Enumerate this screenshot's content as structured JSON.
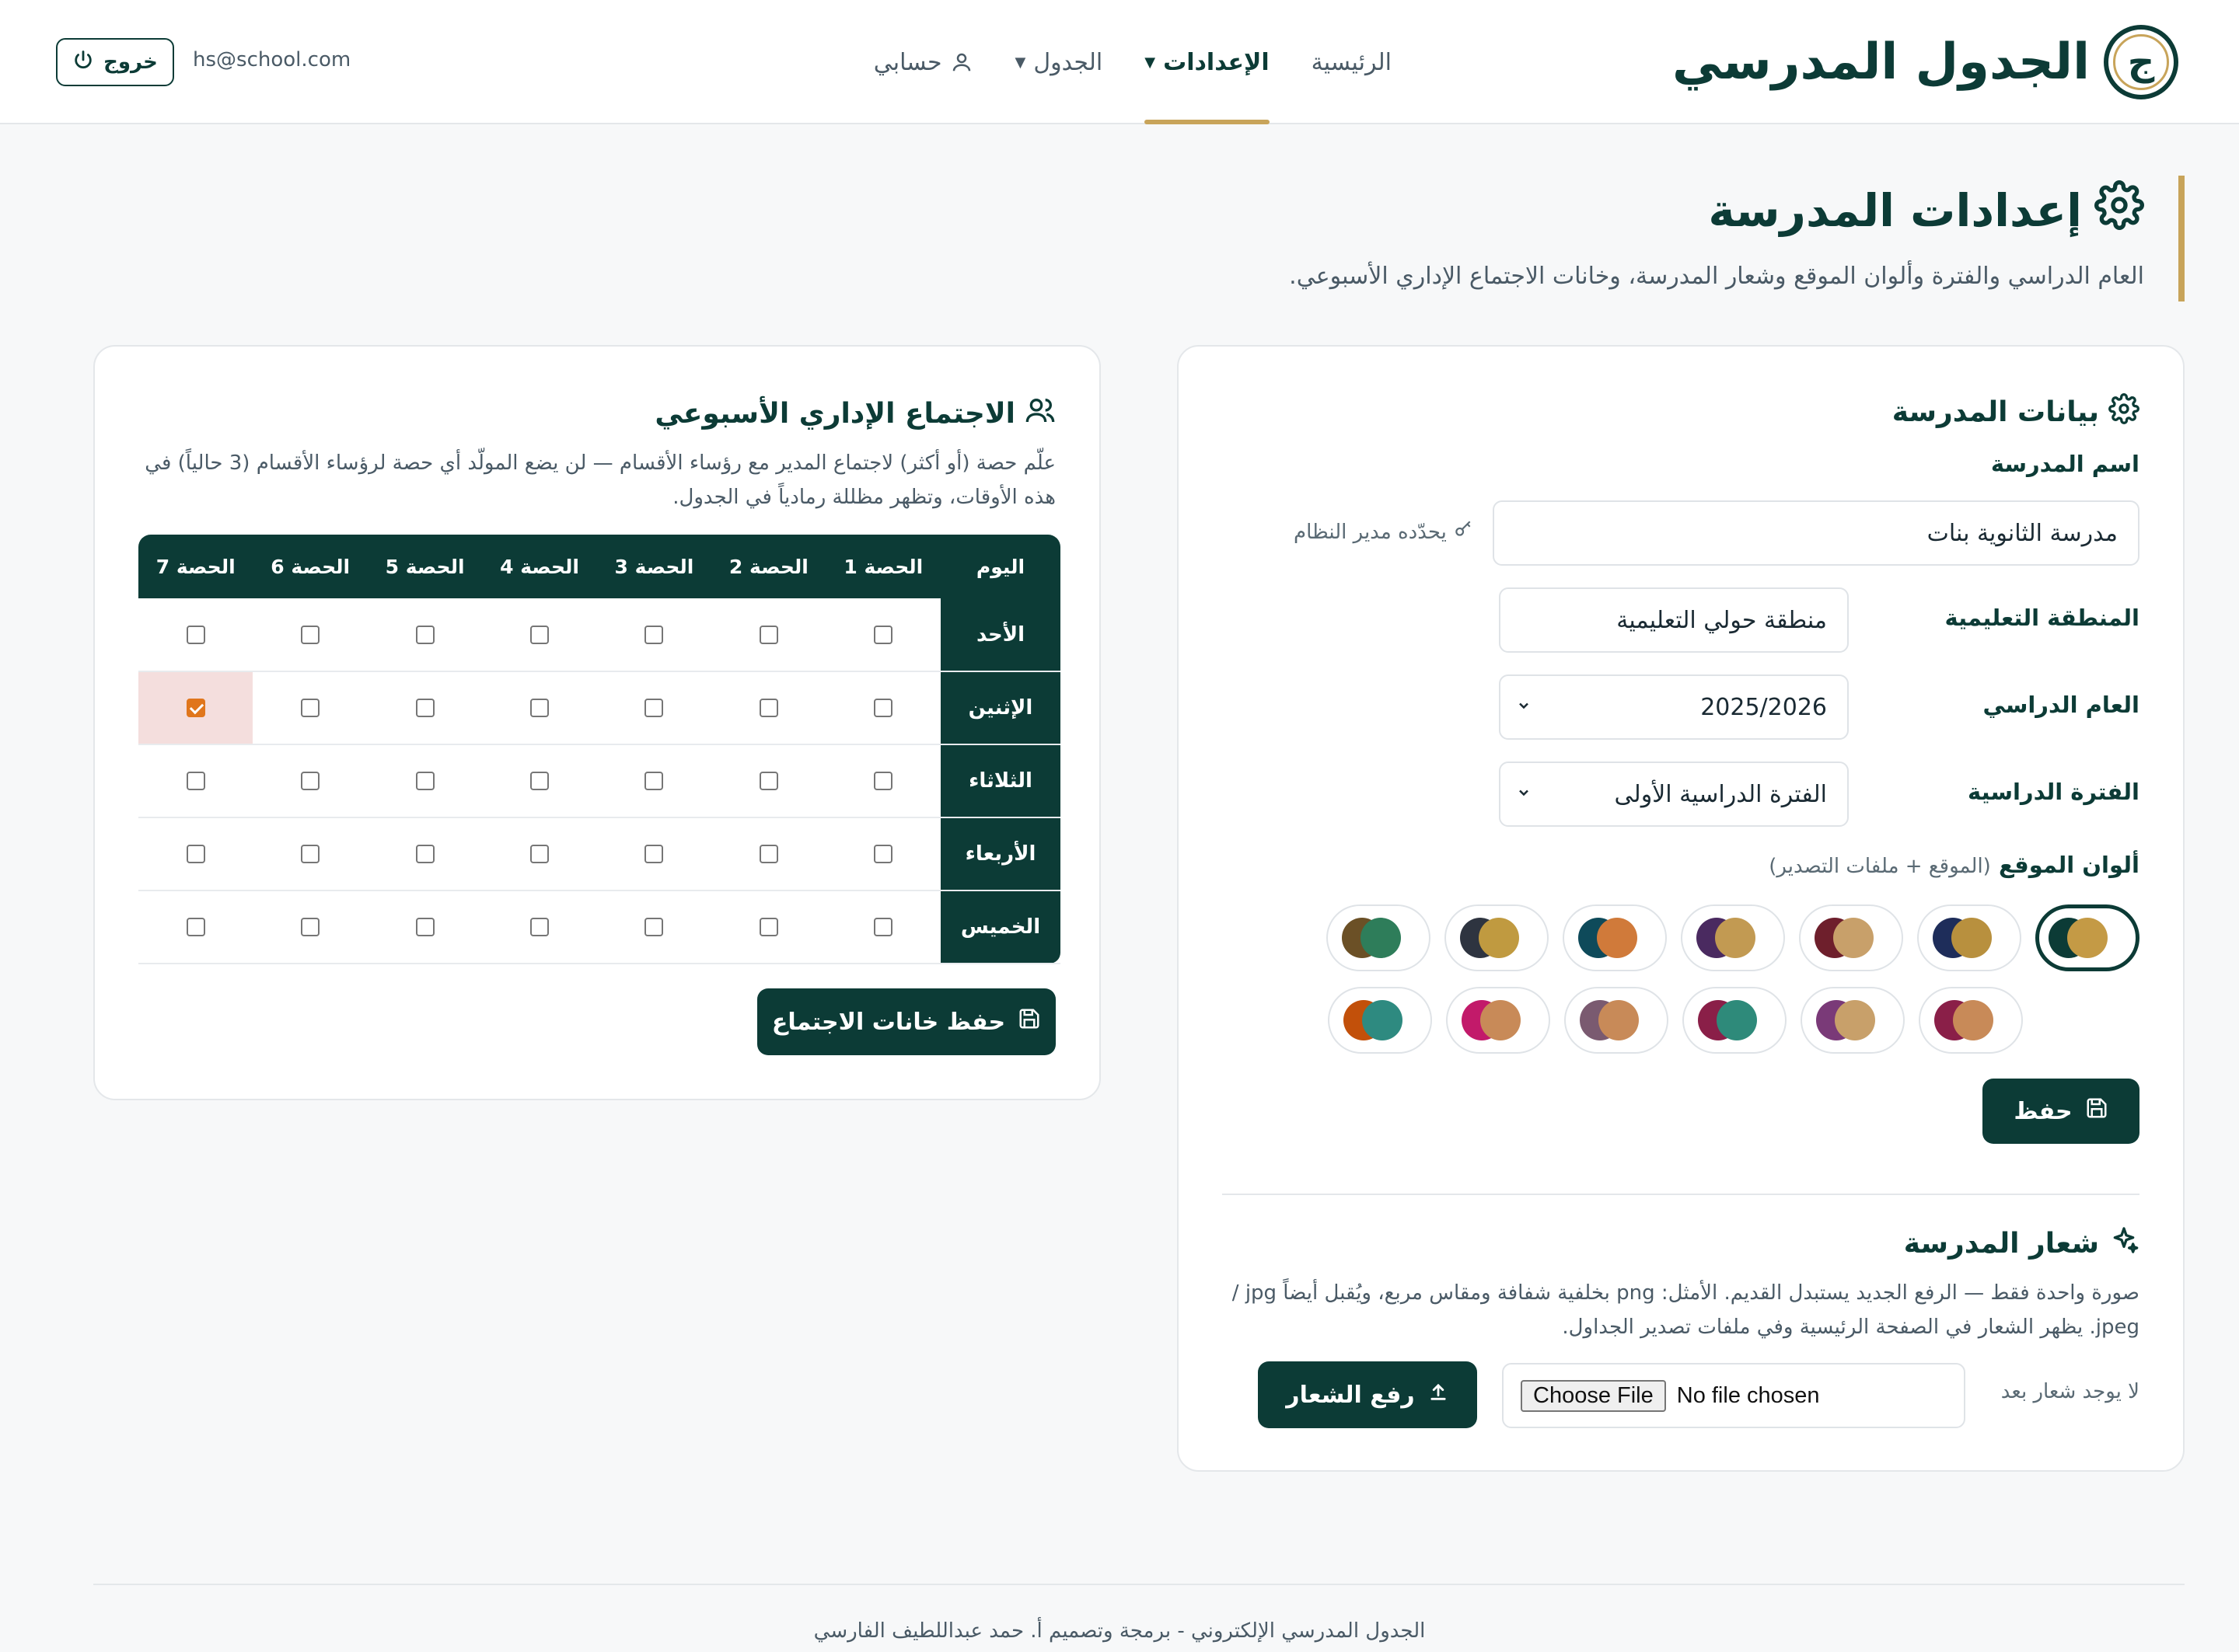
{
  "app": {
    "brand_letter": "ج",
    "brand_title": "الجدول المدرسي"
  },
  "nav": {
    "home": "الرئيسية",
    "settings": "الإعدادات",
    "schedule": "الجدول",
    "account": "حسابي"
  },
  "user": {
    "email": "hs@school.com",
    "logout": "خروج"
  },
  "page": {
    "title": "إعدادات المدرسة",
    "subtitle": "العام الدراسي والفترة وألوان الموقع وشعار المدرسة، وخانات الاجتماع الإداري الأسبوعي."
  },
  "school": {
    "section_title": "بيانات المدرسة",
    "name_label": "اسم المدرسة",
    "name_value": "مدرسة الثانوية بنات",
    "name_hint": "يحدّده مدير النظام",
    "region_label": "المنطقة التعليمية",
    "region_value": "منطقة حولي التعليمية",
    "year_label": "العام الدراسي",
    "year_value": "2025/2026",
    "term_label": "الفترة الدراسية",
    "term_value": "الفترة الدراسية الأولى",
    "colors_label": "ألوان الموقع",
    "colors_note": "(الموقع + ملفات التصدير)",
    "save": "حفظ",
    "palettes_row1": [
      {
        "a": "#c49a45",
        "b": "#0c3b36"
      },
      {
        "a": "#b8903e",
        "b": "#1e2d5a"
      },
      {
        "a": "#c8a06a",
        "b": "#6e1f2c"
      },
      {
        "a": "#c29a52",
        "b": "#4a2a60"
      },
      {
        "a": "#d07a3a",
        "b": "#0e4a5a"
      },
      {
        "a": "#c09a40",
        "b": "#2e3440"
      },
      {
        "a": "#2e7d5a",
        "b": "#6b5026"
      }
    ],
    "palettes_row2": [
      {
        "a": "#c88a58",
        "b": "#8a1f48"
      },
      {
        "a": "#c8a06a",
        "b": "#7a3a78"
      },
      {
        "a": "#2e8a7a",
        "b": "#8a1f48"
      },
      {
        "a": "#c88a58",
        "b": "#7a5a70"
      },
      {
        "a": "#c88a58",
        "b": "#c21a6a"
      },
      {
        "a": "#2e8a80",
        "b": "#c2500a"
      }
    ]
  },
  "logo": {
    "section_title": "شعار المدرسة",
    "desc_line1": "صورة واحدة فقط — الرفع الجديد يستبدل القديم. الأمثل: png بخلفية شفافة ومقاس مربع، ويُقبل أيضاً jpg /",
    "desc_line2": "jpeg. يظهر الشعار في الصفحة الرئيسية وفي ملفات تصدير الجداول.",
    "status": "لا يوجد شعار بعد",
    "file_button": "Choose File",
    "file_none": "No file chosen",
    "upload": "رفع الشعار"
  },
  "meeting": {
    "section_title": "الاجتماع الإداري الأسبوعي",
    "desc_line1": "علّم حصة (أو أكثر) لاجتماع المدير مع رؤساء الأقسام — لن يضع المولّد أي حصة لرؤساء الأقسام (3 حالياً) في",
    "desc_line2": "هذه الأوقات، وتظهر مظللة رمادياً في الجدول.",
    "day_header": "اليوم",
    "periods": [
      "الحصة 1",
      "الحصة 2",
      "الحصة 3",
      "الحصة 4",
      "الحصة 5",
      "الحصة 6",
      "الحصة 7"
    ],
    "days": [
      "الأحد",
      "الإثنين",
      "الثلاثاء",
      "الأربعاء",
      "الخميس"
    ],
    "checked": [
      [
        false,
        false,
        false,
        false,
        false,
        false,
        false
      ],
      [
        false,
        false,
        false,
        false,
        false,
        false,
        true
      ],
      [
        false,
        false,
        false,
        false,
        false,
        false,
        false
      ],
      [
        false,
        false,
        false,
        false,
        false,
        false,
        false
      ],
      [
        false,
        false,
        false,
        false,
        false,
        false,
        false
      ]
    ],
    "save": "حفظ خانات الاجتماع"
  },
  "footer": {
    "text": "الجدول المدرسي الإلكتروني - برمجة وتصميم أ. حمد عبداللطيف الفارسي"
  },
  "colors": {
    "primary": "#0c3b36",
    "accent": "#c8a45a",
    "marked_cell": "#f4dedd",
    "checkbox_on": "#e0761c"
  }
}
